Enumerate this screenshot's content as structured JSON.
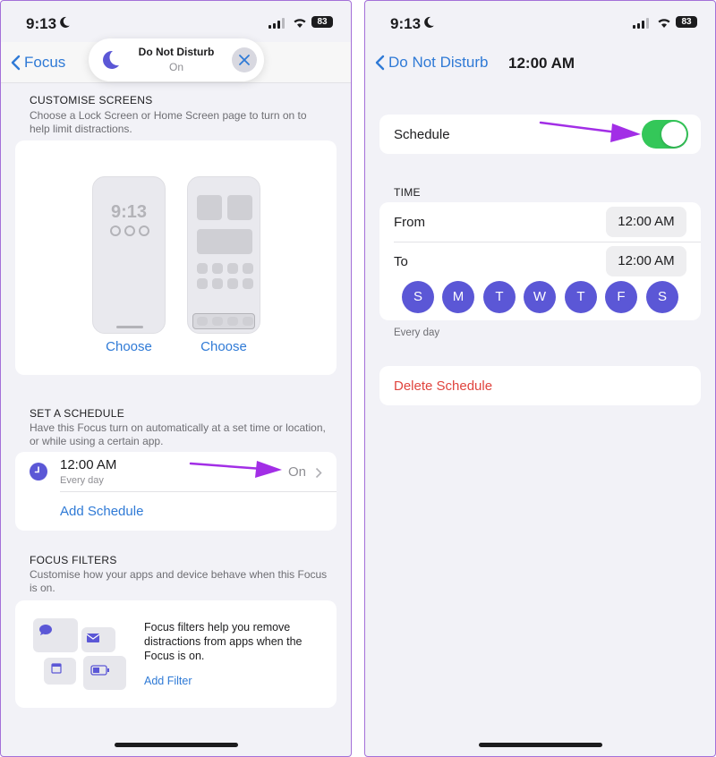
{
  "left": {
    "status": {
      "time": "9:13",
      "battery": "83"
    },
    "nav": {
      "back_label": "Focus"
    },
    "dnd_pill": {
      "title": "Do Not Disturb",
      "state": "On"
    },
    "customise": {
      "header": "CUSTOMISE SCREENS",
      "description": "Choose a Lock Screen or Home Screen page to turn on to help limit distractions.",
      "lock_clock": "9:13",
      "choose_lock": "Choose",
      "choose_home": "Choose"
    },
    "schedule": {
      "header": "SET A SCHEDULE",
      "description": "Have this Focus turn on automatically at a set time or location, or while using a certain app.",
      "time": "12:00 AM",
      "days": "Every day",
      "state": "On",
      "add_label": "Add Schedule"
    },
    "filters": {
      "header": "FOCUS FILTERS",
      "description": "Customise how your apps and device behave when this Focus is on.",
      "body": "Focus filters help you remove distractions from apps when the Focus is on.",
      "add_label": "Add Filter"
    }
  },
  "right": {
    "status": {
      "time": "9:13",
      "battery": "83"
    },
    "nav": {
      "back_label": "Do Not Disturb",
      "title": "12:00 AM"
    },
    "schedule_toggle": {
      "label": "Schedule",
      "on": true
    },
    "time_section": {
      "header": "TIME",
      "from_label": "From",
      "from_value": "12:00 AM",
      "to_label": "To",
      "to_value": "12:00 AM",
      "days": [
        "S",
        "M",
        "T",
        "W",
        "T",
        "F",
        "S"
      ],
      "footer": "Every day"
    },
    "delete_label": "Delete Schedule"
  },
  "colors": {
    "accent_blue": "#2f7ad6",
    "day_purple": "#5b57d6",
    "toggle_green": "#34c759",
    "delete_red": "#e0443e",
    "annotation_arrow": "#a22ee6"
  }
}
